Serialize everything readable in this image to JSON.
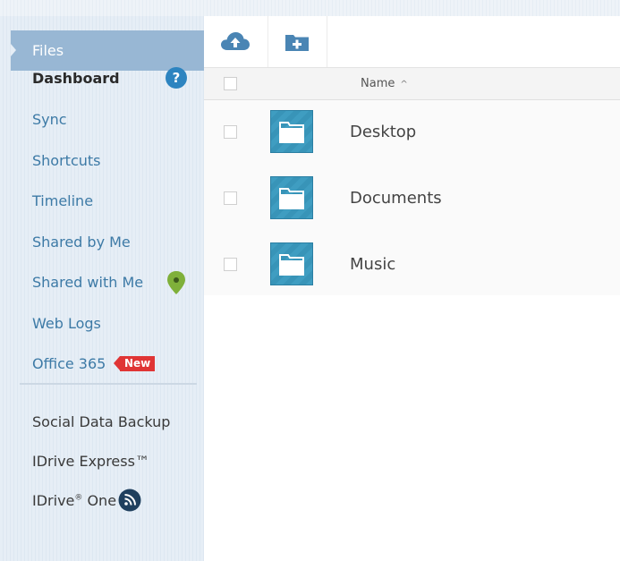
{
  "sidebar": {
    "active": "Files",
    "items": [
      {
        "label": "Dashboard"
      },
      {
        "label": "Sync"
      },
      {
        "label": "Shortcuts"
      },
      {
        "label": "Timeline"
      },
      {
        "label": "Shared by Me"
      },
      {
        "label": "Shared with Me"
      },
      {
        "label": "Web Logs"
      },
      {
        "label": "Office 365"
      }
    ],
    "help_badge": "?",
    "new_badge": "New",
    "secondary": [
      {
        "label": "Social Data Backup"
      },
      {
        "label": "IDrive Express™"
      },
      {
        "label": "IDrive",
        "sup": "®",
        "suffix": " One"
      }
    ]
  },
  "toolbar": {
    "upload_icon": "cloud-upload-icon",
    "new_folder_icon": "folder-plus-icon"
  },
  "list": {
    "column_name": "Name",
    "sort_indicator": "^",
    "files": [
      {
        "name": "Desktop",
        "type": "folder"
      },
      {
        "name": "Documents",
        "type": "folder"
      },
      {
        "name": "Music",
        "type": "folder"
      }
    ]
  },
  "colors": {
    "sidebar_active": "#98b7d4",
    "link": "#3d7aa6",
    "folder": "#3f9dc1",
    "new_badge": "#e03535",
    "help": "#2d84c0",
    "pin": "#7fb03a"
  }
}
